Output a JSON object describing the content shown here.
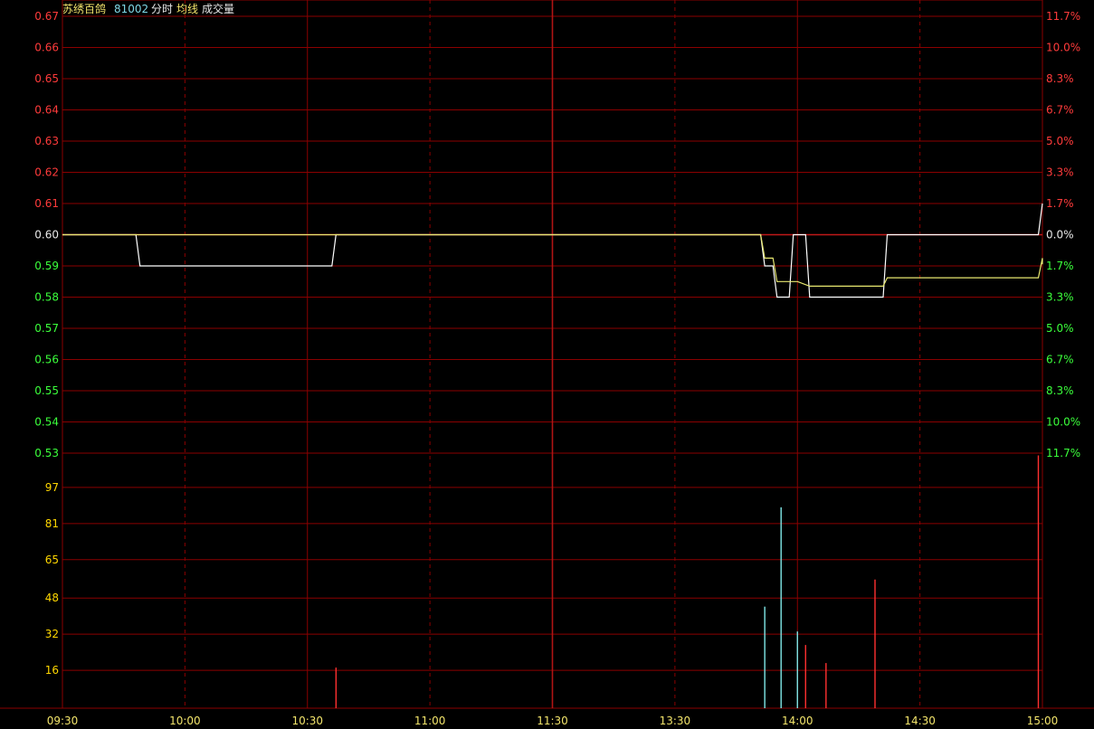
{
  "header": {
    "name": "苏绣百鸽",
    "code": "81002",
    "fenshi": "分时",
    "avg_label": "均线",
    "vol_label": "成交量"
  },
  "colors": {
    "grid": "#8b0000",
    "grid_dash": "#7a1010",
    "up": "#ff3b3b",
    "down": "#3bff3b",
    "flat": "#e8e8e8",
    "price_line": "#ffffff",
    "avg_line": "#e8e870",
    "vol_label": "#ffd700",
    "vol_up": "#ff3030",
    "vol_down": "#80e8e8",
    "time_label": "#f2e46b"
  },
  "chart_data": {
    "type": "line",
    "prev_close": 0.6,
    "price_axis": {
      "ylim": [
        0.53,
        0.67
      ],
      "ticks": [
        "0.67",
        "0.66",
        "0.65",
        "0.64",
        "0.63",
        "0.62",
        "0.61",
        "0.60",
        "0.59",
        "0.58",
        "0.57",
        "0.56",
        "0.55",
        "0.54",
        "0.53"
      ]
    },
    "pct_axis": {
      "ticks": [
        "11.7%",
        "10.0%",
        "8.3%",
        "6.7%",
        "5.0%",
        "3.3%",
        "1.7%",
        "0.0%",
        "1.7%",
        "3.3%",
        "5.0%",
        "6.7%",
        "8.3%",
        "10.0%",
        "11.7%"
      ]
    },
    "volume_axis": {
      "ylim": [
        0,
        113
      ],
      "ticks": [
        "97",
        "81",
        "65",
        "48",
        "32",
        "16"
      ]
    },
    "time_axis": {
      "ticks": [
        "09:30",
        "10:00",
        "10:30",
        "11:00",
        "11:30",
        "13:30",
        "14:00",
        "14:30",
        "15:00"
      ]
    },
    "series": [
      {
        "name": "分时",
        "points": [
          [
            "09:30",
            0.6
          ],
          [
            "09:48",
            0.6
          ],
          [
            "09:49",
            0.59
          ],
          [
            "10:36",
            0.59
          ],
          [
            "10:37",
            0.6
          ],
          [
            "13:51",
            0.6
          ],
          [
            "13:52",
            0.59
          ],
          [
            "13:54",
            0.59
          ],
          [
            "13:55",
            0.58
          ],
          [
            "13:58",
            0.58
          ],
          [
            "13:59",
            0.6
          ],
          [
            "14:02",
            0.6
          ],
          [
            "14:03",
            0.58
          ],
          [
            "14:21",
            0.58
          ],
          [
            "14:22",
            0.6
          ],
          [
            "14:59",
            0.6
          ],
          [
            "15:00",
            0.61
          ]
        ]
      },
      {
        "name": "均线",
        "points": [
          [
            "09:30",
            0.6
          ],
          [
            "13:51",
            0.6
          ],
          [
            "13:52",
            0.5925
          ],
          [
            "13:54",
            0.5925
          ],
          [
            "13:55",
            0.585
          ],
          [
            "13:58",
            0.585
          ],
          [
            "14:00",
            0.585
          ],
          [
            "14:03",
            0.5835
          ],
          [
            "14:21",
            0.5835
          ],
          [
            "14:22",
            0.5862
          ],
          [
            "14:59",
            0.5862
          ],
          [
            "15:00",
            0.5925
          ],
          [
            "15:00",
            0.5905
          ]
        ]
      }
    ],
    "volume": [
      {
        "t": "10:37",
        "v": 18,
        "dir": "up"
      },
      {
        "t": "13:52",
        "v": 45,
        "dir": "down"
      },
      {
        "t": "13:56",
        "v": 89,
        "dir": "down"
      },
      {
        "t": "14:00",
        "v": 34,
        "dir": "down"
      },
      {
        "t": "14:02",
        "v": 28,
        "dir": "up"
      },
      {
        "t": "14:07",
        "v": 20,
        "dir": "up"
      },
      {
        "t": "14:19",
        "v": 57,
        "dir": "up"
      },
      {
        "t": "14:59",
        "v": 112,
        "dir": "up"
      }
    ]
  }
}
